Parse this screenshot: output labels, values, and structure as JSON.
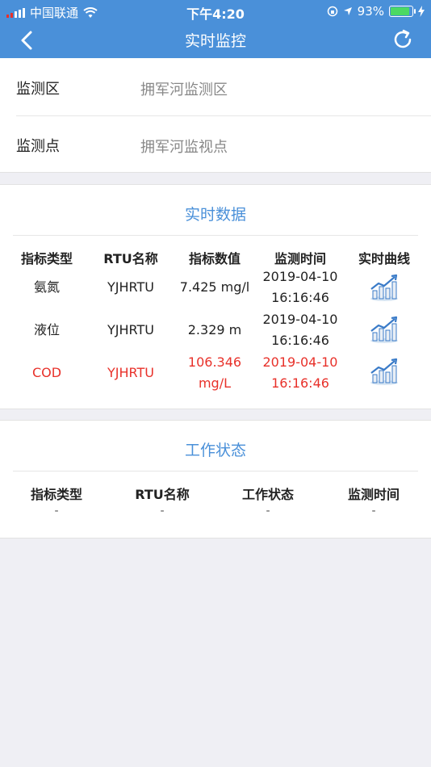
{
  "status_bar": {
    "carrier": "中国联通",
    "time": "下午4:20",
    "battery_pct": "93%",
    "battery_level": 0.93
  },
  "nav": {
    "title": "实时监控",
    "back_icon": "chevron-left-icon",
    "refresh_icon": "refresh-icon"
  },
  "info": {
    "zone_label": "监测区",
    "zone_value": "拥军河监测区",
    "point_label": "监测点",
    "point_value": "拥军河监视点"
  },
  "realtime": {
    "title": "实时数据",
    "headers": [
      "指标类型",
      "RTU名称",
      "指标数值",
      "监测时间",
      "实时曲线"
    ],
    "rows": [
      {
        "type": "氨氮",
        "rtu": "YJHRTU",
        "value": "7.425 mg/l",
        "value2": "",
        "date": "2019-04-10",
        "time": "16:16:46",
        "alert": false
      },
      {
        "type": "液位",
        "rtu": "YJHRTU",
        "value": "2.329 m",
        "value2": "",
        "date": "2019-04-10",
        "time": "16:16:46",
        "alert": false
      },
      {
        "type": "COD",
        "rtu": "YJHRTU",
        "value": "106.346",
        "value2": "mg/L",
        "date": "2019-04-10",
        "time": "16:16:46",
        "alert": true
      }
    ],
    "chart_icon": "trend-chart-icon",
    "alert_color": "#e8312a"
  },
  "work_status": {
    "title": "工作状态",
    "headers": [
      "指标类型",
      "RTU名称",
      "工作状态",
      "监测时间"
    ],
    "values": [
      "-",
      "-",
      "-",
      "-"
    ]
  },
  "colors": {
    "accent": "#4a90d9",
    "alert": "#e8312a"
  }
}
